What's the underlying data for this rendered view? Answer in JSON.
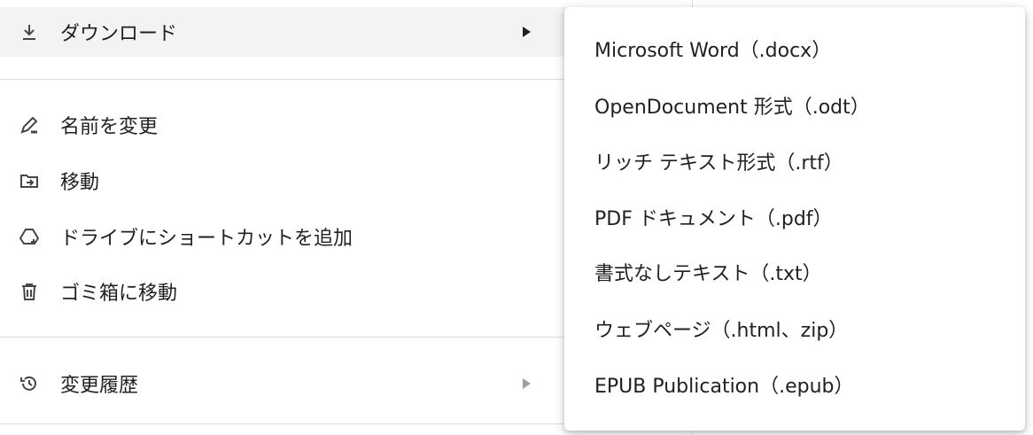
{
  "file_menu": {
    "items": [
      {
        "label": "ダウンロード",
        "icon": "download-icon",
        "has_submenu": true,
        "active": true
      },
      {
        "label": "名前を変更",
        "icon": "rename-icon",
        "has_submenu": false
      },
      {
        "label": "移動",
        "icon": "move-folder-icon",
        "has_submenu": false
      },
      {
        "label": "ドライブにショートカットを追加",
        "icon": "add-shortcut-drive-icon",
        "has_submenu": false
      },
      {
        "label": "ゴミ箱に移動",
        "icon": "trash-icon",
        "has_submenu": false
      },
      {
        "label": "変更履歴",
        "icon": "history-icon",
        "has_submenu": true,
        "active": false
      }
    ]
  },
  "download_submenu": {
    "items": [
      {
        "label": "Microsoft Word（.docx）"
      },
      {
        "label": "OpenDocument 形式（.odt）"
      },
      {
        "label": "リッチ テキスト形式（.rtf）"
      },
      {
        "label": "PDF ドキュメント（.pdf）"
      },
      {
        "label": "書式なしテキスト（.txt）"
      },
      {
        "label": "ウェブページ（.html、zip）"
      },
      {
        "label": "EPUB Publication（.epub）"
      }
    ]
  },
  "colors": {
    "active_item_bg": "#f1f3f4",
    "separator": "#dadce0",
    "text": "#202124",
    "icon": "#444746"
  }
}
